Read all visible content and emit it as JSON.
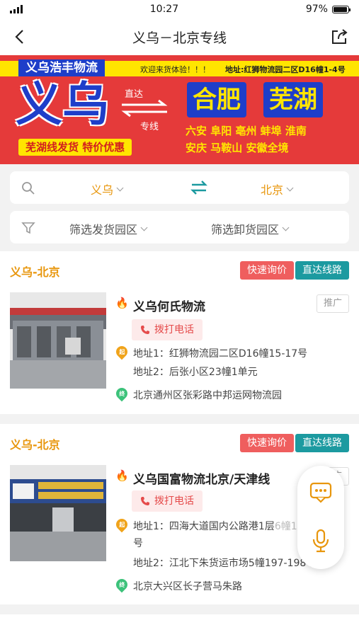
{
  "status": {
    "time": "10:27",
    "battery": "97%",
    "battery_level": 0.97
  },
  "nav": {
    "title": "义乌－北京专线",
    "back_icon": "chevron-left-icon",
    "share_icon": "share-icon"
  },
  "banner": {
    "brand": "义乌浩丰物流",
    "welcome": "欢迎来货体验！！！",
    "address": "地址:红狮物流园二区D16幢1-4号",
    "origin": "义乌",
    "direct": "直达",
    "line": "专线",
    "city1": "合肥",
    "city2": "芜湖",
    "row1": "六安  阜阳  亳州  蚌埠  淮南",
    "row2": "安庆  马鞍山   安徽全境",
    "promo": "芜湖线发货 特价优惠"
  },
  "search": {
    "from": "义乌",
    "to": "北京"
  },
  "filters": {
    "ship_park": "筛选发货园区",
    "unload_park": "筛选卸货园区"
  },
  "routes": [
    {
      "title": "义乌-北京",
      "inquiry": "快速询价",
      "direct": "直达线路",
      "company": "义乌何氏物流",
      "promo": "推广",
      "call": "拨打电话",
      "origin_tag": "起",
      "addr1": "地址1：红狮物流园二区D16幢15-17号",
      "addr2": "地址2：后张小区23幢1单元",
      "dest_tag": "终",
      "dest": "北京通州区张彩路中邦运网物流园"
    },
    {
      "title": "义乌-北京",
      "inquiry": "快速询价",
      "direct": "直达线路",
      "company": "义乌国富物流北京/天津线",
      "promo": "推广",
      "call": "拨打电话",
      "origin_tag": "起",
      "addr1": "地址1：四海大道国内公路港1层",
      "addr1_cont": "6幢10号13",
      "addr1_wrap": "号",
      "addr2": "地址2：江北下朱货运市场5幢197-198号",
      "dest_tag": "终",
      "dest": "北京大兴区长子营马朱路"
    }
  ],
  "colors": {
    "accent": "#e8960c",
    "red": "#ef5e5e",
    "teal": "#1c9aa0",
    "banner_red": "#e53a3a",
    "banner_blue": "#1e3ec9",
    "banner_yellow": "#ffe500"
  }
}
